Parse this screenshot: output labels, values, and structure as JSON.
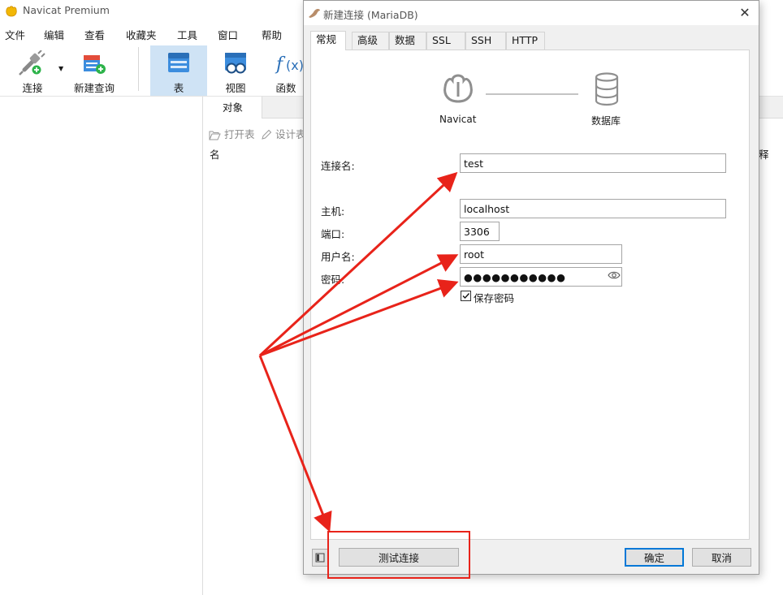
{
  "app": {
    "title": "Navicat Premium",
    "logo_icon": "navicat-leaf-icon"
  },
  "menu": [
    "文件",
    "编辑",
    "查看",
    "收藏夹",
    "工具",
    "窗口",
    "帮助"
  ],
  "toolbar": {
    "connect_label": "连接",
    "new_query_label": "新建查询",
    "table_label": "表",
    "view_label": "视图",
    "function_label": "函数"
  },
  "objects_tab": {
    "label": "对象"
  },
  "object_toolbar": {
    "open_table": "打开表",
    "design_table": "设计表"
  },
  "object_list": {
    "name_header": "名",
    "right_fragment": "释"
  },
  "dialog": {
    "title": "新建连接 (MariaDB)",
    "close_glyph": "✕",
    "tabs": [
      {
        "label": "常规",
        "active": true
      },
      {
        "label": "高级"
      },
      {
        "label": "数据库"
      },
      {
        "label": "SSL"
      },
      {
        "label": "SSH"
      },
      {
        "label": "HTTP"
      }
    ],
    "diagram": {
      "left_label": "Navicat",
      "right_label": "数据库"
    },
    "fields": {
      "connection_name": {
        "label": "连接名:",
        "value": "test"
      },
      "host": {
        "label": "主机:",
        "value": "localhost"
      },
      "port": {
        "label": "端口:",
        "value": "3306"
      },
      "username": {
        "label": "用户名:",
        "value": "root"
      },
      "password": {
        "label": "密码:",
        "value": "●●●●●●●●●●●"
      }
    },
    "save_password": {
      "label": "保存密码",
      "checked": true
    },
    "buttons": {
      "test": "测试连接",
      "ok": "确定",
      "cancel": "取消"
    }
  },
  "colors": {
    "accent": "#0078d7",
    "toolbar_selected": "#cfe3f5",
    "annotation_red": "#e8231a"
  }
}
